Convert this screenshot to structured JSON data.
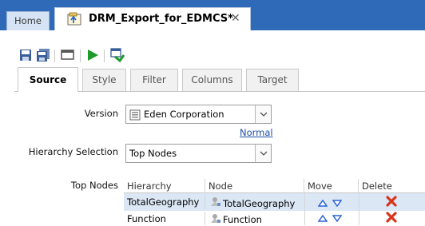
{
  "tabs": {
    "home_label": "Home",
    "doc_label": "DRM_Export_for_EDMCS*",
    "close_glyph": "✕"
  },
  "toolbar": {
    "icons": [
      "save-icon",
      "save-all-icon",
      "window-icon",
      "run-icon",
      "run-export-icon"
    ]
  },
  "subtabs": [
    "Source",
    "Style",
    "Filter",
    "Columns",
    "Target"
  ],
  "active_subtab": "Source",
  "form": {
    "version_label": "Version",
    "version_value": "Eden Corporation",
    "version_link": "Normal",
    "hierarchy_label": "Hierarchy Selection",
    "hierarchy_value": "Top Nodes",
    "top_nodes_label": "Top Nodes"
  },
  "grid": {
    "columns": [
      "Hierarchy",
      "Node",
      "Move",
      "Delete"
    ],
    "rows": [
      {
        "hierarchy": "TotalGeography",
        "node": "TotalGeography"
      },
      {
        "hierarchy": "Function",
        "node": "Function"
      }
    ]
  },
  "colors": {
    "tabstrip": "#2f6ab9",
    "link": "#1f4fa8",
    "delete": "#d8341a",
    "arrows": "#2b63d6",
    "run": "#1c9b2a"
  }
}
